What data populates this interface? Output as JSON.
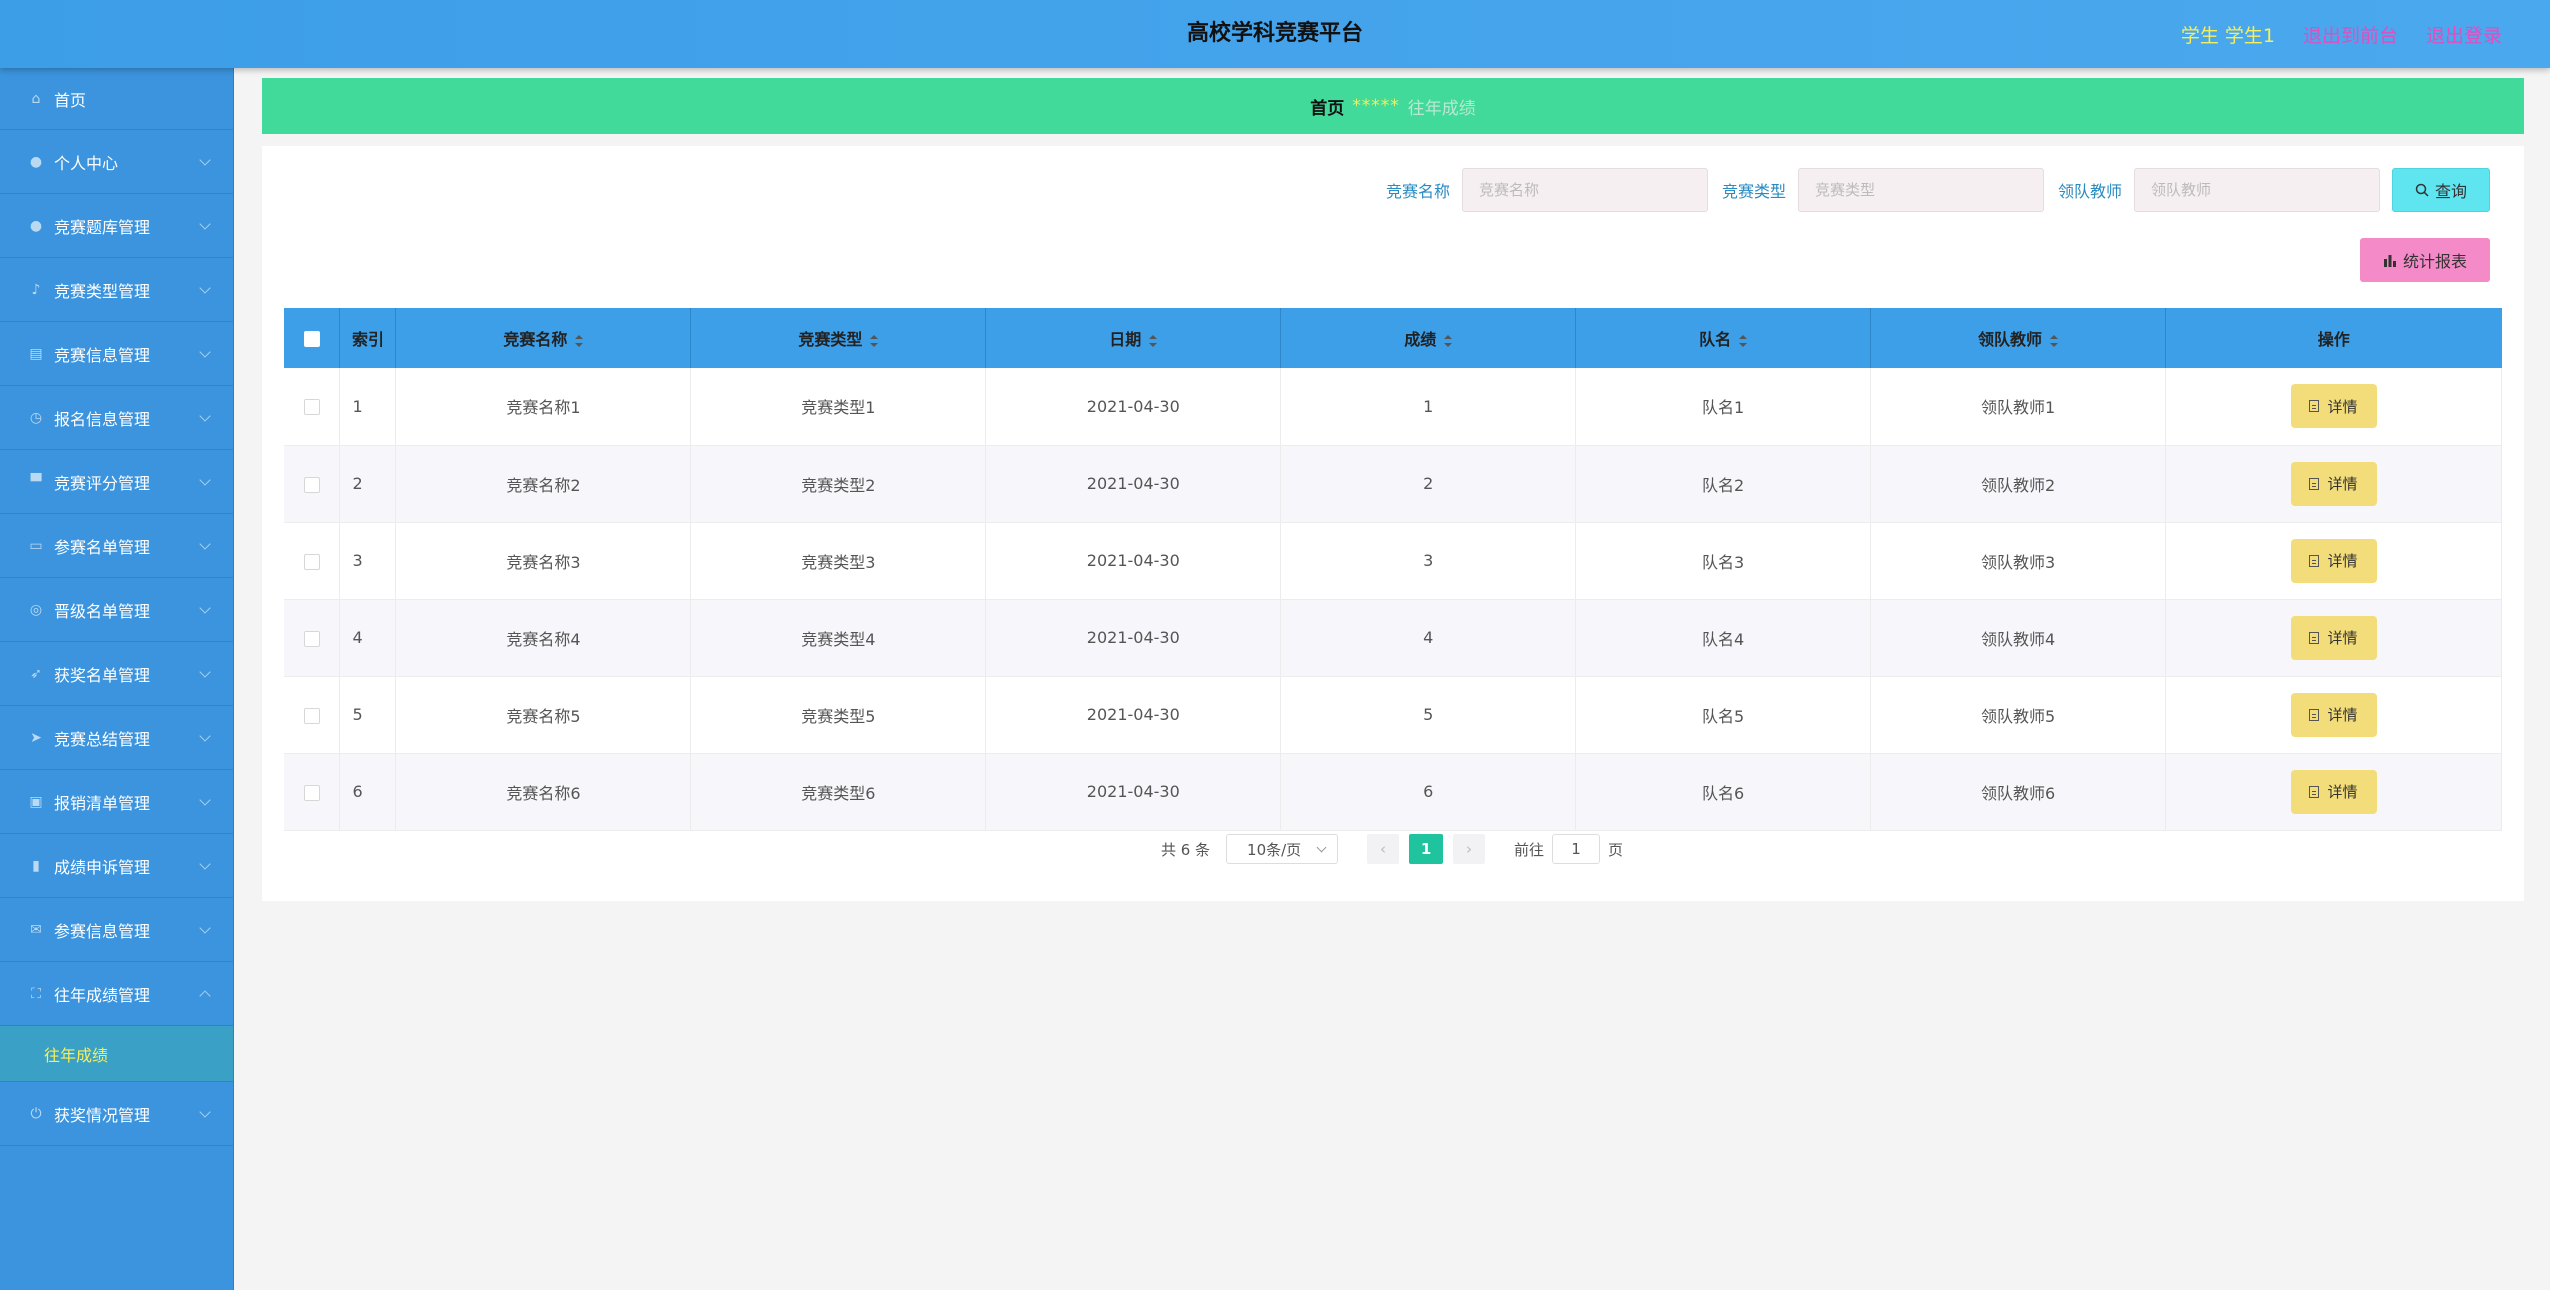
{
  "header": {
    "title": "高校学科竞赛平台",
    "user_role": "学生 学生1",
    "front_link": "退出到前台",
    "logout_link": "退出登录"
  },
  "sidebar": {
    "items": [
      {
        "label": "首页",
        "icon": "home-icon"
      },
      {
        "label": "个人中心",
        "icon": "user-icon"
      },
      {
        "label": "竞赛题库管理",
        "icon": "user-icon"
      },
      {
        "label": "竞赛类型管理",
        "icon": "mic-icon"
      },
      {
        "label": "竞赛信息管理",
        "icon": "clipboard-icon"
      },
      {
        "label": "报名信息管理",
        "icon": "clock-icon"
      },
      {
        "label": "竞赛评分管理",
        "icon": "stamp-icon"
      },
      {
        "label": "参赛名单管理",
        "icon": "chat-icon"
      },
      {
        "label": "晋级名单管理",
        "icon": "globe-icon"
      },
      {
        "label": "获奖名单管理",
        "icon": "rocket-icon"
      },
      {
        "label": "竞赛总结管理",
        "icon": "send-icon"
      },
      {
        "label": "报销清单管理",
        "icon": "picture-icon"
      },
      {
        "label": "成绩申诉管理",
        "icon": "chart-icon"
      },
      {
        "label": "参赛信息管理",
        "icon": "mail-icon"
      },
      {
        "label": "往年成绩管理",
        "icon": "fullscreen-icon"
      },
      {
        "label": "获奖情况管理",
        "icon": "power-icon"
      }
    ],
    "submenu_label": "往年成绩"
  },
  "breadcrumb": {
    "home": "首页",
    "stars": "*****",
    "current": "往年成绩"
  },
  "search": {
    "name_label": "竞赛名称",
    "name_placeholder": "竞赛名称",
    "type_label": "竞赛类型",
    "type_placeholder": "竞赛类型",
    "teacher_label": "领队教师",
    "teacher_placeholder": "领队教师",
    "query_button": "查询",
    "report_button": "统计报表"
  },
  "table": {
    "headers": [
      "索引",
      "竞赛名称",
      "竞赛类型",
      "日期",
      "成绩",
      "队名",
      "领队教师",
      "操作"
    ],
    "detail_button": "详情",
    "rows": [
      {
        "index": "1",
        "name": "竞赛名称1",
        "type": "竞赛类型1",
        "date": "2021-04-30",
        "score": "1",
        "team": "队名1",
        "teacher": "领队教师1"
      },
      {
        "index": "2",
        "name": "竞赛名称2",
        "type": "竞赛类型2",
        "date": "2021-04-30",
        "score": "2",
        "team": "队名2",
        "teacher": "领队教师2"
      },
      {
        "index": "3",
        "name": "竞赛名称3",
        "type": "竞赛类型3",
        "date": "2021-04-30",
        "score": "3",
        "team": "队名3",
        "teacher": "领队教师3"
      },
      {
        "index": "4",
        "name": "竞赛名称4",
        "type": "竞赛类型4",
        "date": "2021-04-30",
        "score": "4",
        "team": "队名4",
        "teacher": "领队教师4"
      },
      {
        "index": "5",
        "name": "竞赛名称5",
        "type": "竞赛类型5",
        "date": "2021-04-30",
        "score": "5",
        "team": "队名5",
        "teacher": "领队教师5"
      },
      {
        "index": "6",
        "name": "竞赛名称6",
        "type": "竞赛类型6",
        "date": "2021-04-30",
        "score": "6",
        "team": "队名6",
        "teacher": "领队教师6"
      }
    ]
  },
  "pager": {
    "total": "共 6 条",
    "page_size": "10条/页",
    "current_page": "1",
    "goto_label": "前往",
    "goto_value": "1",
    "goto_unit": "页"
  },
  "colors": {
    "header_bg": "#4aa8ee",
    "sidebar_bg": "#3b94dd",
    "breadcrumb_bg": "#42da9a",
    "query_btn": "#5ee5ef",
    "report_btn": "#f48ac8",
    "detail_btn": "#f2dd7a",
    "active_page": "#1fc49f"
  }
}
